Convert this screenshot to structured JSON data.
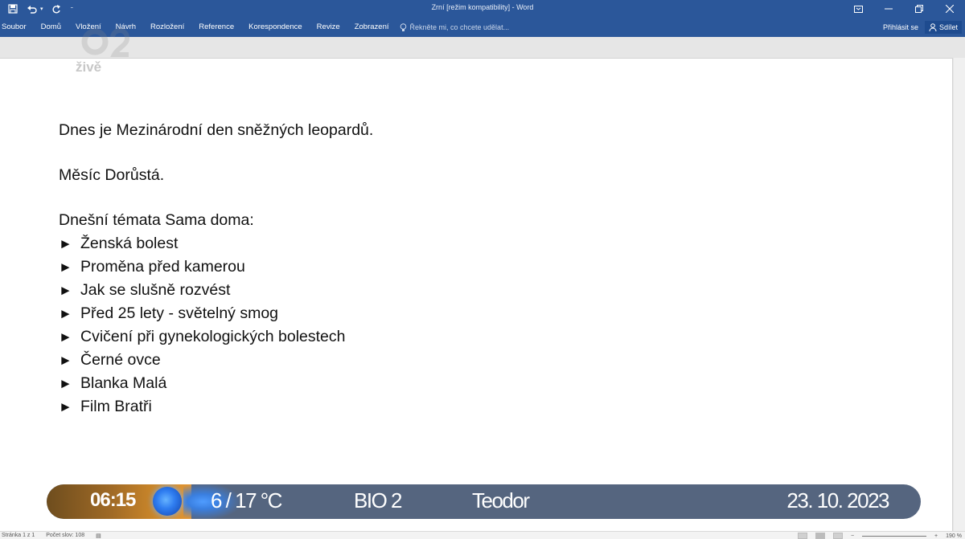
{
  "window": {
    "title": "Zrní [režim kompatibility] - Word",
    "quick_access": [
      "save-icon",
      "undo-icon",
      "redo-icon",
      "customize-icon"
    ],
    "controls": [
      "ribbon-display-icon",
      "minimize-icon",
      "restore-icon",
      "close-icon"
    ]
  },
  "ribbon": {
    "tabs": [
      "Soubor",
      "Domů",
      "Vložení",
      "Návrh",
      "Rozložení",
      "Reference",
      "Korespondence",
      "Revize",
      "Zobrazení"
    ],
    "tell_me": "Řekněte mi, co chcete udělat...",
    "sign_in": "Přihlásit se",
    "share": "Sdílet"
  },
  "watermark": {
    "channel_text": "živě"
  },
  "document": {
    "line1": "Dnes je Mezinárodní den sněžných leopardů.",
    "line2": "Měsíc Dorůstá.",
    "topics_heading": "Dnešní témata Sama doma:",
    "bullet_symbol": "►",
    "topics": [
      "Ženská bolest",
      "Proměna před kamerou",
      "Jak se slušně rozvést",
      "Před 25 lety - světelný smog",
      "Cvičení při gynekologických bolestech",
      "Černé ovce",
      "Blanka Malá",
      "Film Bratři"
    ]
  },
  "status_bar": {
    "page": "Stránka 1 z 1",
    "words": "Počet slov: 108",
    "zoom": "190 %"
  },
  "tv_strip": {
    "time": "06:15",
    "temperature": "6 / 17 °C",
    "channel": "BIO 2",
    "name_day": "Teodor",
    "date": "23. 10. 2023"
  },
  "colors": {
    "ribbon": "#2b579a",
    "tv_strip": "#55657f",
    "tv_accent": "#e39531",
    "tv_ball": "#2f7df0"
  }
}
